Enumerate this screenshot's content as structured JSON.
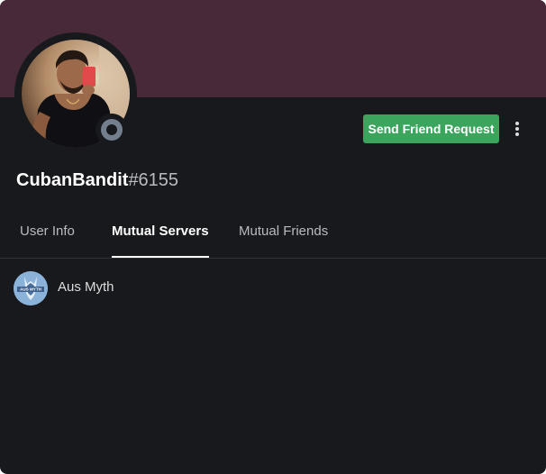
{
  "profile": {
    "username": "CubanBandit",
    "discriminator": "#6155",
    "status": "offline",
    "banner_color": "#47293a"
  },
  "actions": {
    "send_friend_request_label": "Send Friend Request",
    "more_icon": "vertical-ellipsis-icon"
  },
  "tabs": [
    {
      "label": "User Info",
      "active": false
    },
    {
      "label": "Mutual Servers",
      "active": true
    },
    {
      "label": "Mutual Friends",
      "active": false
    }
  ],
  "mutual_servers": [
    {
      "name": "Aus Myth",
      "icon_text": "AUS MYTH"
    }
  ],
  "colors": {
    "button_green": "#3ba55d",
    "background": "#18191c",
    "status_offline": "#747f8d"
  }
}
